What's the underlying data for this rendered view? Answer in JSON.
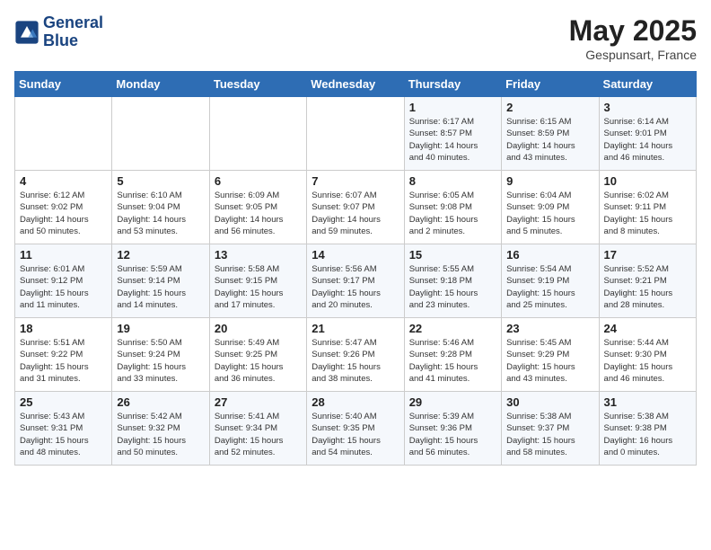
{
  "header": {
    "logo_line1": "General",
    "logo_line2": "Blue",
    "month": "May 2025",
    "location": "Gespunsart, France"
  },
  "weekdays": [
    "Sunday",
    "Monday",
    "Tuesday",
    "Wednesday",
    "Thursday",
    "Friday",
    "Saturday"
  ],
  "weeks": [
    [
      {
        "day": "",
        "info": ""
      },
      {
        "day": "",
        "info": ""
      },
      {
        "day": "",
        "info": ""
      },
      {
        "day": "",
        "info": ""
      },
      {
        "day": "1",
        "info": "Sunrise: 6:17 AM\nSunset: 8:57 PM\nDaylight: 14 hours\nand 40 minutes."
      },
      {
        "day": "2",
        "info": "Sunrise: 6:15 AM\nSunset: 8:59 PM\nDaylight: 14 hours\nand 43 minutes."
      },
      {
        "day": "3",
        "info": "Sunrise: 6:14 AM\nSunset: 9:01 PM\nDaylight: 14 hours\nand 46 minutes."
      }
    ],
    [
      {
        "day": "4",
        "info": "Sunrise: 6:12 AM\nSunset: 9:02 PM\nDaylight: 14 hours\nand 50 minutes."
      },
      {
        "day": "5",
        "info": "Sunrise: 6:10 AM\nSunset: 9:04 PM\nDaylight: 14 hours\nand 53 minutes."
      },
      {
        "day": "6",
        "info": "Sunrise: 6:09 AM\nSunset: 9:05 PM\nDaylight: 14 hours\nand 56 minutes."
      },
      {
        "day": "7",
        "info": "Sunrise: 6:07 AM\nSunset: 9:07 PM\nDaylight: 14 hours\nand 59 minutes."
      },
      {
        "day": "8",
        "info": "Sunrise: 6:05 AM\nSunset: 9:08 PM\nDaylight: 15 hours\nand 2 minutes."
      },
      {
        "day": "9",
        "info": "Sunrise: 6:04 AM\nSunset: 9:09 PM\nDaylight: 15 hours\nand 5 minutes."
      },
      {
        "day": "10",
        "info": "Sunrise: 6:02 AM\nSunset: 9:11 PM\nDaylight: 15 hours\nand 8 minutes."
      }
    ],
    [
      {
        "day": "11",
        "info": "Sunrise: 6:01 AM\nSunset: 9:12 PM\nDaylight: 15 hours\nand 11 minutes."
      },
      {
        "day": "12",
        "info": "Sunrise: 5:59 AM\nSunset: 9:14 PM\nDaylight: 15 hours\nand 14 minutes."
      },
      {
        "day": "13",
        "info": "Sunrise: 5:58 AM\nSunset: 9:15 PM\nDaylight: 15 hours\nand 17 minutes."
      },
      {
        "day": "14",
        "info": "Sunrise: 5:56 AM\nSunset: 9:17 PM\nDaylight: 15 hours\nand 20 minutes."
      },
      {
        "day": "15",
        "info": "Sunrise: 5:55 AM\nSunset: 9:18 PM\nDaylight: 15 hours\nand 23 minutes."
      },
      {
        "day": "16",
        "info": "Sunrise: 5:54 AM\nSunset: 9:19 PM\nDaylight: 15 hours\nand 25 minutes."
      },
      {
        "day": "17",
        "info": "Sunrise: 5:52 AM\nSunset: 9:21 PM\nDaylight: 15 hours\nand 28 minutes."
      }
    ],
    [
      {
        "day": "18",
        "info": "Sunrise: 5:51 AM\nSunset: 9:22 PM\nDaylight: 15 hours\nand 31 minutes."
      },
      {
        "day": "19",
        "info": "Sunrise: 5:50 AM\nSunset: 9:24 PM\nDaylight: 15 hours\nand 33 minutes."
      },
      {
        "day": "20",
        "info": "Sunrise: 5:49 AM\nSunset: 9:25 PM\nDaylight: 15 hours\nand 36 minutes."
      },
      {
        "day": "21",
        "info": "Sunrise: 5:47 AM\nSunset: 9:26 PM\nDaylight: 15 hours\nand 38 minutes."
      },
      {
        "day": "22",
        "info": "Sunrise: 5:46 AM\nSunset: 9:28 PM\nDaylight: 15 hours\nand 41 minutes."
      },
      {
        "day": "23",
        "info": "Sunrise: 5:45 AM\nSunset: 9:29 PM\nDaylight: 15 hours\nand 43 minutes."
      },
      {
        "day": "24",
        "info": "Sunrise: 5:44 AM\nSunset: 9:30 PM\nDaylight: 15 hours\nand 46 minutes."
      }
    ],
    [
      {
        "day": "25",
        "info": "Sunrise: 5:43 AM\nSunset: 9:31 PM\nDaylight: 15 hours\nand 48 minutes."
      },
      {
        "day": "26",
        "info": "Sunrise: 5:42 AM\nSunset: 9:32 PM\nDaylight: 15 hours\nand 50 minutes."
      },
      {
        "day": "27",
        "info": "Sunrise: 5:41 AM\nSunset: 9:34 PM\nDaylight: 15 hours\nand 52 minutes."
      },
      {
        "day": "28",
        "info": "Sunrise: 5:40 AM\nSunset: 9:35 PM\nDaylight: 15 hours\nand 54 minutes."
      },
      {
        "day": "29",
        "info": "Sunrise: 5:39 AM\nSunset: 9:36 PM\nDaylight: 15 hours\nand 56 minutes."
      },
      {
        "day": "30",
        "info": "Sunrise: 5:38 AM\nSunset: 9:37 PM\nDaylight: 15 hours\nand 58 minutes."
      },
      {
        "day": "31",
        "info": "Sunrise: 5:38 AM\nSunset: 9:38 PM\nDaylight: 16 hours\nand 0 minutes."
      }
    ]
  ]
}
